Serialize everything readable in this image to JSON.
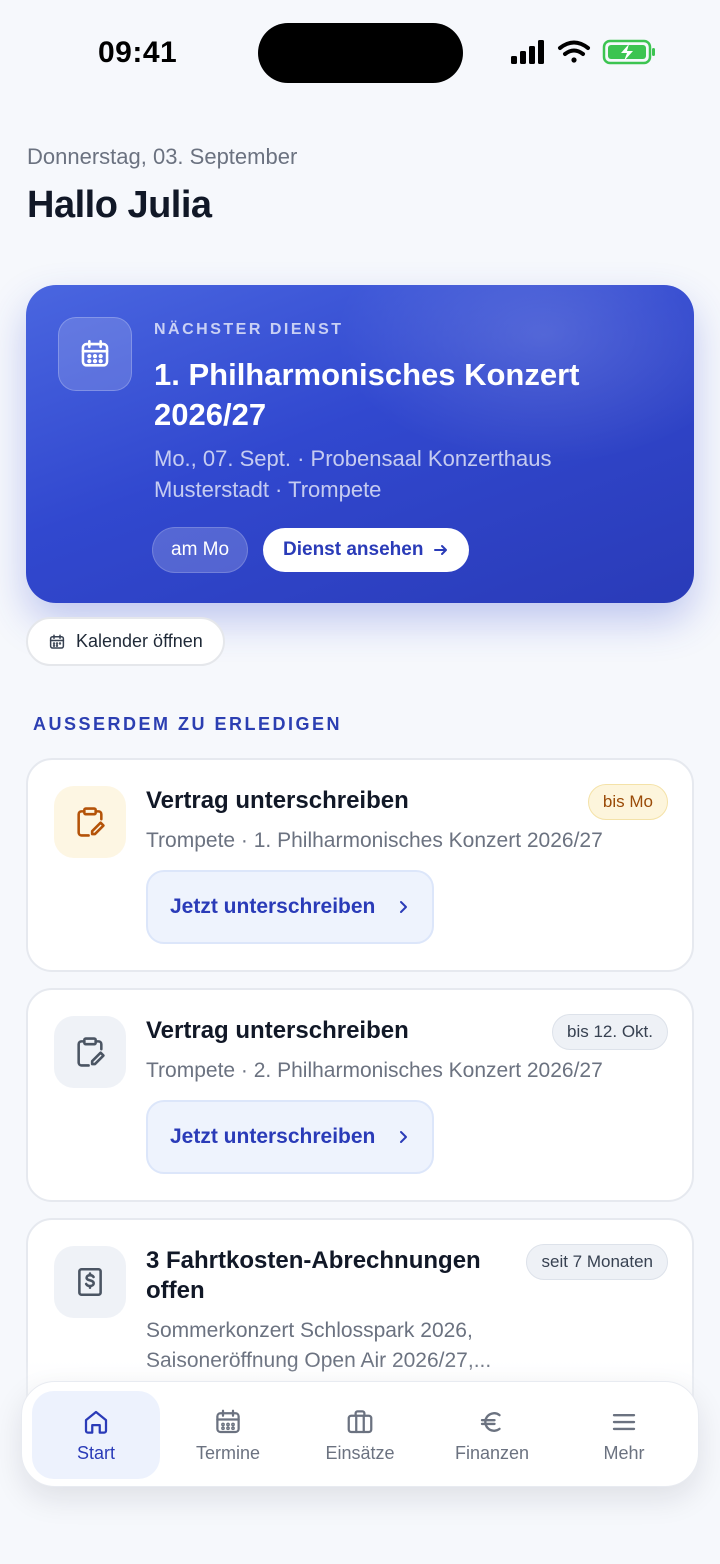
{
  "status_bar": {
    "time": "09:41"
  },
  "header": {
    "date": "Donnerstag, 03. September",
    "greeting": "Hallo Julia"
  },
  "next_service": {
    "eyebrow": "NÄCHSTER DIENST",
    "title": "1. Philharmonisches Konzert 2026/27",
    "subtitle": "Mo., 07. Sept. · Probensaal Konzerthaus Musterstadt · Trompete",
    "chip": "am Mo",
    "button_label": "Dienst ansehen"
  },
  "calendar_button": "Kalender öffnen",
  "todo": {
    "section_label": "AUSSERDEM ZU ERLEDIGEN",
    "items": [
      {
        "title": "Vertrag unterschreiben",
        "subtitle": "Trompete · 1. Philharmonisches Konzert 2026/27",
        "badge": "bis Mo",
        "action": "Jetzt unterschreiben"
      },
      {
        "title": "Vertrag unterschreiben",
        "subtitle": "Trompete · 2. Philharmonisches Konzert 2026/27",
        "badge": "bis 12. Okt.",
        "action": "Jetzt unterschreiben"
      },
      {
        "title": "3 Fahrtkosten-Abrechnungen offen",
        "subtitle": "Sommerkonzert Schlosspark 2026, Saisoneröffnung Open Air 2026/27,...",
        "badge": "seit 7 Monaten"
      }
    ]
  },
  "nav": {
    "items": [
      {
        "label": "Start",
        "icon": "home-icon"
      },
      {
        "label": "Termine",
        "icon": "calendar-icon"
      },
      {
        "label": "Einsätze",
        "icon": "briefcase-icon"
      },
      {
        "label": "Finanzen",
        "icon": "euro-icon"
      },
      {
        "label": "Mehr",
        "icon": "menu-icon"
      }
    ]
  },
  "colors": {
    "accent": "#2a3bb8",
    "hero_gradient_start": "#4a66e0",
    "hero_gradient_end": "#2a3bb8",
    "warn_badge_text": "#9a4b08",
    "background": "#f6f8fc"
  }
}
